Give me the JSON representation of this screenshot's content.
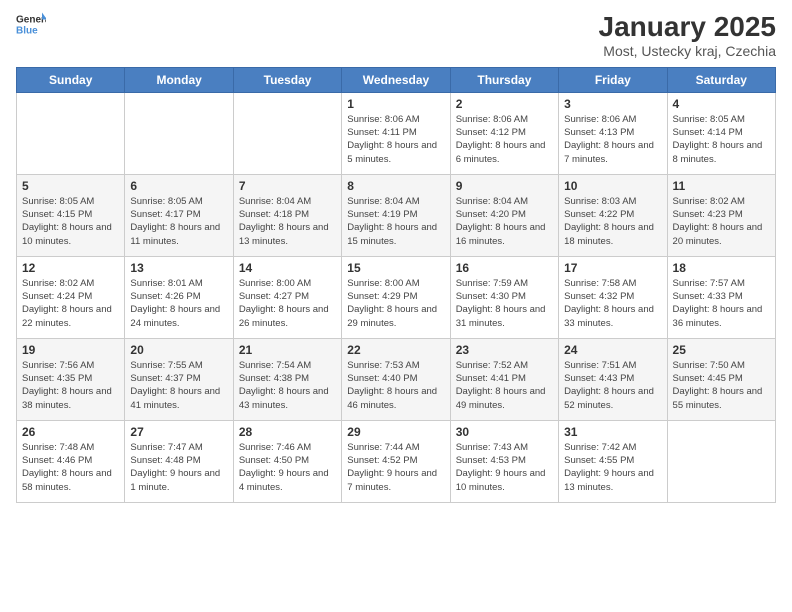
{
  "header": {
    "logo_general": "General",
    "logo_blue": "Blue",
    "title": "January 2025",
    "subtitle": "Most, Ustecky kraj, Czechia"
  },
  "days_of_week": [
    "Sunday",
    "Monday",
    "Tuesday",
    "Wednesday",
    "Thursday",
    "Friday",
    "Saturday"
  ],
  "weeks": [
    [
      {
        "day": "",
        "info": ""
      },
      {
        "day": "",
        "info": ""
      },
      {
        "day": "",
        "info": ""
      },
      {
        "day": "1",
        "info": "Sunrise: 8:06 AM\nSunset: 4:11 PM\nDaylight: 8 hours\nand 5 minutes."
      },
      {
        "day": "2",
        "info": "Sunrise: 8:06 AM\nSunset: 4:12 PM\nDaylight: 8 hours\nand 6 minutes."
      },
      {
        "day": "3",
        "info": "Sunrise: 8:06 AM\nSunset: 4:13 PM\nDaylight: 8 hours\nand 7 minutes."
      },
      {
        "day": "4",
        "info": "Sunrise: 8:05 AM\nSunset: 4:14 PM\nDaylight: 8 hours\nand 8 minutes."
      }
    ],
    [
      {
        "day": "5",
        "info": "Sunrise: 8:05 AM\nSunset: 4:15 PM\nDaylight: 8 hours\nand 10 minutes."
      },
      {
        "day": "6",
        "info": "Sunrise: 8:05 AM\nSunset: 4:17 PM\nDaylight: 8 hours\nand 11 minutes."
      },
      {
        "day": "7",
        "info": "Sunrise: 8:04 AM\nSunset: 4:18 PM\nDaylight: 8 hours\nand 13 minutes."
      },
      {
        "day": "8",
        "info": "Sunrise: 8:04 AM\nSunset: 4:19 PM\nDaylight: 8 hours\nand 15 minutes."
      },
      {
        "day": "9",
        "info": "Sunrise: 8:04 AM\nSunset: 4:20 PM\nDaylight: 8 hours\nand 16 minutes."
      },
      {
        "day": "10",
        "info": "Sunrise: 8:03 AM\nSunset: 4:22 PM\nDaylight: 8 hours\nand 18 minutes."
      },
      {
        "day": "11",
        "info": "Sunrise: 8:02 AM\nSunset: 4:23 PM\nDaylight: 8 hours\nand 20 minutes."
      }
    ],
    [
      {
        "day": "12",
        "info": "Sunrise: 8:02 AM\nSunset: 4:24 PM\nDaylight: 8 hours\nand 22 minutes."
      },
      {
        "day": "13",
        "info": "Sunrise: 8:01 AM\nSunset: 4:26 PM\nDaylight: 8 hours\nand 24 minutes."
      },
      {
        "day": "14",
        "info": "Sunrise: 8:00 AM\nSunset: 4:27 PM\nDaylight: 8 hours\nand 26 minutes."
      },
      {
        "day": "15",
        "info": "Sunrise: 8:00 AM\nSunset: 4:29 PM\nDaylight: 8 hours\nand 29 minutes."
      },
      {
        "day": "16",
        "info": "Sunrise: 7:59 AM\nSunset: 4:30 PM\nDaylight: 8 hours\nand 31 minutes."
      },
      {
        "day": "17",
        "info": "Sunrise: 7:58 AM\nSunset: 4:32 PM\nDaylight: 8 hours\nand 33 minutes."
      },
      {
        "day": "18",
        "info": "Sunrise: 7:57 AM\nSunset: 4:33 PM\nDaylight: 8 hours\nand 36 minutes."
      }
    ],
    [
      {
        "day": "19",
        "info": "Sunrise: 7:56 AM\nSunset: 4:35 PM\nDaylight: 8 hours\nand 38 minutes."
      },
      {
        "day": "20",
        "info": "Sunrise: 7:55 AM\nSunset: 4:37 PM\nDaylight: 8 hours\nand 41 minutes."
      },
      {
        "day": "21",
        "info": "Sunrise: 7:54 AM\nSunset: 4:38 PM\nDaylight: 8 hours\nand 43 minutes."
      },
      {
        "day": "22",
        "info": "Sunrise: 7:53 AM\nSunset: 4:40 PM\nDaylight: 8 hours\nand 46 minutes."
      },
      {
        "day": "23",
        "info": "Sunrise: 7:52 AM\nSunset: 4:41 PM\nDaylight: 8 hours\nand 49 minutes."
      },
      {
        "day": "24",
        "info": "Sunrise: 7:51 AM\nSunset: 4:43 PM\nDaylight: 8 hours\nand 52 minutes."
      },
      {
        "day": "25",
        "info": "Sunrise: 7:50 AM\nSunset: 4:45 PM\nDaylight: 8 hours\nand 55 minutes."
      }
    ],
    [
      {
        "day": "26",
        "info": "Sunrise: 7:48 AM\nSunset: 4:46 PM\nDaylight: 8 hours\nand 58 minutes."
      },
      {
        "day": "27",
        "info": "Sunrise: 7:47 AM\nSunset: 4:48 PM\nDaylight: 9 hours\nand 1 minute."
      },
      {
        "day": "28",
        "info": "Sunrise: 7:46 AM\nSunset: 4:50 PM\nDaylight: 9 hours\nand 4 minutes."
      },
      {
        "day": "29",
        "info": "Sunrise: 7:44 AM\nSunset: 4:52 PM\nDaylight: 9 hours\nand 7 minutes."
      },
      {
        "day": "30",
        "info": "Sunrise: 7:43 AM\nSunset: 4:53 PM\nDaylight: 9 hours\nand 10 minutes."
      },
      {
        "day": "31",
        "info": "Sunrise: 7:42 AM\nSunset: 4:55 PM\nDaylight: 9 hours\nand 13 minutes."
      },
      {
        "day": "",
        "info": ""
      }
    ]
  ]
}
